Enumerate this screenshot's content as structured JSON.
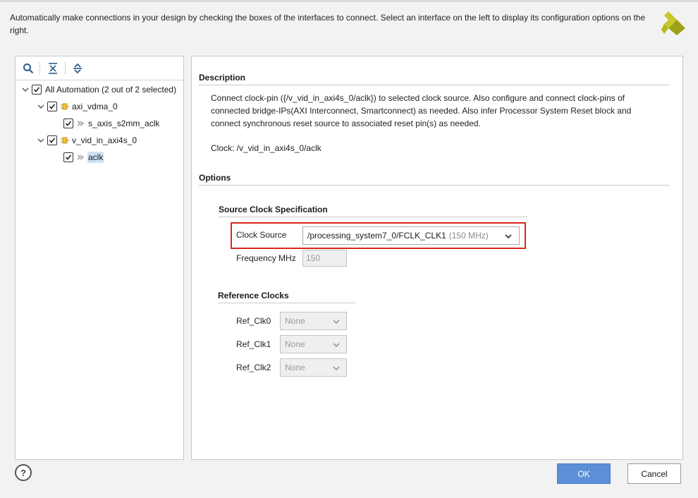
{
  "header": {
    "instructions": "Automatically make connections in your design by checking the boxes of the interfaces to connect. Select an interface on the left to display its configuration options on the right."
  },
  "toolbar": {
    "search_icon": "search-icon",
    "collapse_icon": "collapse-all-icon",
    "expand_icon": "expand-all-icon"
  },
  "tree": {
    "root": {
      "label": "All Automation (2 out of 2 selected)",
      "checked": true,
      "expanded": true
    },
    "nodes": [
      {
        "label": "axi_vdma_0",
        "checked": true,
        "expanded": true,
        "icon": "ip-block-icon",
        "children": [
          {
            "label": "s_axis_s2mm_aclk",
            "checked": true,
            "icon": "clock-pin-icon"
          }
        ]
      },
      {
        "label": "v_vid_in_axi4s_0",
        "checked": true,
        "expanded": true,
        "icon": "ip-block-icon",
        "children": [
          {
            "label": "aclk",
            "checked": true,
            "icon": "clock-pin-icon",
            "selected": true
          }
        ]
      }
    ]
  },
  "description": {
    "title": "Description",
    "text": "Connect clock-pin ({/v_vid_in_axi4s_0/aclk}) to selected clock source. Also configure and connect clock-pins of connected bridge-IPs(AXI Interconnect, Smartconnect) as needed. Also infer Processor System Reset block and connect synchronous reset source to associated reset pin(s) as needed.",
    "clock": "Clock: /v_vid_in_axi4s_0/aclk"
  },
  "options": {
    "title": "Options",
    "source_clock": {
      "title": "Source Clock Specification",
      "clock_source_label": "Clock Source",
      "clock_source_value": "/processing_system7_0/FCLK_CLK1",
      "clock_source_freq": "(150 MHz)",
      "frequency_label": "Frequency MHz",
      "frequency_value": "150"
    },
    "reference_clocks": {
      "title": "Reference Clocks",
      "items": [
        {
          "label": "Ref_Clk0",
          "value": "None"
        },
        {
          "label": "Ref_Clk1",
          "value": "None"
        },
        {
          "label": "Ref_Clk2",
          "value": "None"
        }
      ]
    }
  },
  "footer": {
    "help_label": "?",
    "ok_label": "OK",
    "cancel_label": "Cancel"
  },
  "colors": {
    "accent": "#5b8fd8",
    "highlight": "#e0241d",
    "logo": "#b5b81a",
    "selection": "#cfe3f7"
  }
}
